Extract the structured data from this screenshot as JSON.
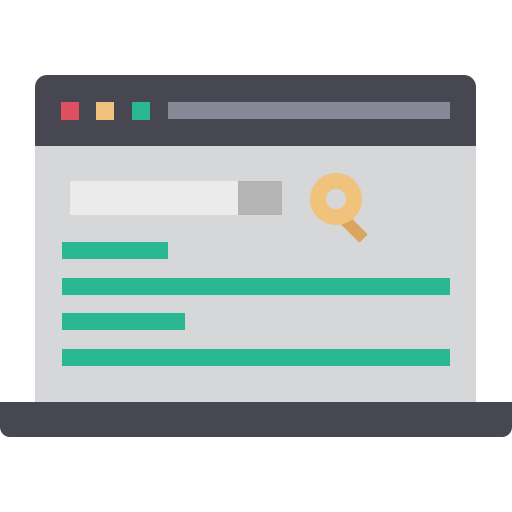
{
  "colors": {
    "frame": "#474752",
    "screen": "#d6d7d8",
    "dot_close": "#e04f5f",
    "dot_minimize": "#f0c27b",
    "dot_maximize": "#29b892",
    "address_bar": "#868896",
    "search_field": "#ebebeb",
    "search_button": "#b4b4b4",
    "magnifier_lens": "#f0c27b",
    "magnifier_handle": "#dba55d",
    "result_line": "#29b892"
  },
  "icons": {
    "window_controls": [
      "close-icon",
      "minimize-icon",
      "maximize-icon"
    ],
    "search": "magnifier-icon"
  },
  "results": [
    {
      "name": "result-line-1"
    },
    {
      "name": "result-line-2"
    },
    {
      "name": "result-line-3"
    },
    {
      "name": "result-line-4"
    }
  ]
}
